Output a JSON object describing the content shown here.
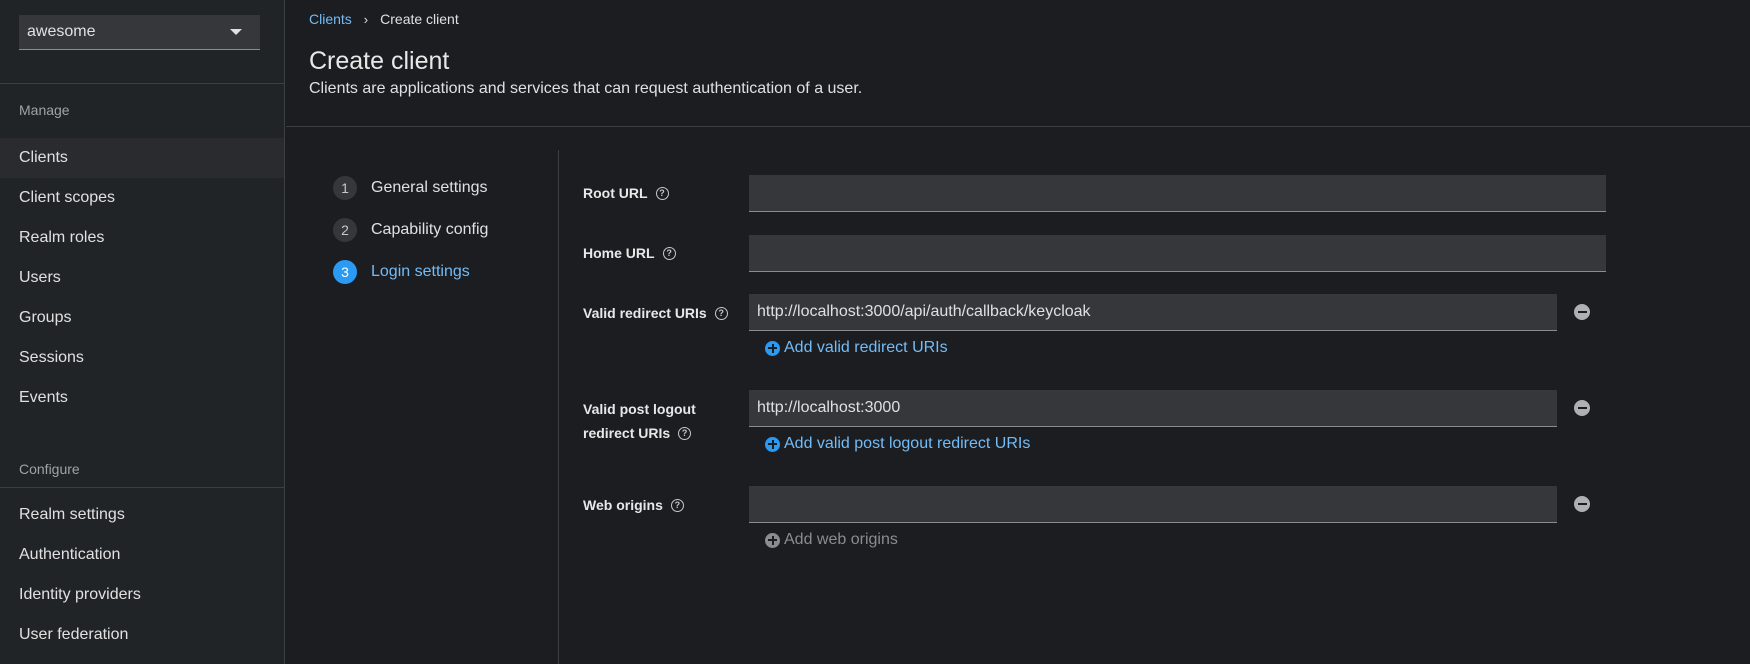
{
  "sidebar": {
    "realm": "awesome",
    "sections": [
      {
        "title": "Manage",
        "items": [
          "Clients",
          "Client scopes",
          "Realm roles",
          "Users",
          "Groups",
          "Sessions",
          "Events"
        ]
      },
      {
        "title": "Configure",
        "items": [
          "Realm settings",
          "Authentication",
          "Identity providers",
          "User federation"
        ]
      }
    ],
    "active_item": "Clients"
  },
  "breadcrumb": {
    "link": "Clients",
    "current": "Create client"
  },
  "page": {
    "title": "Create client",
    "description": "Clients are applications and services that can request authentication of a user."
  },
  "wizard": {
    "steps": [
      {
        "number": "1",
        "label": "General settings"
      },
      {
        "number": "2",
        "label": "Capability config"
      },
      {
        "number": "3",
        "label": "Login settings"
      }
    ],
    "current_step": 3
  },
  "form": {
    "root_url": {
      "label": "Root URL",
      "value": ""
    },
    "home_url": {
      "label": "Home URL",
      "value": ""
    },
    "valid_redirect_uris": {
      "label": "Valid redirect URIs",
      "value": "http://localhost:3000/api/auth/callback/keycloak",
      "add_label": "Add valid redirect URIs"
    },
    "valid_post_logout": {
      "label_line1": "Valid post logout",
      "label_line2": "redirect URIs",
      "value": "http://localhost:3000",
      "add_label": "Add valid post logout redirect URIs"
    },
    "web_origins": {
      "label": "Web origins",
      "value": "",
      "add_label": "Add web origins"
    }
  },
  "colors": {
    "accent": "#2b9af3",
    "link": "#73bcf7",
    "background": "#1b1d21",
    "sidebar": "#212427"
  }
}
